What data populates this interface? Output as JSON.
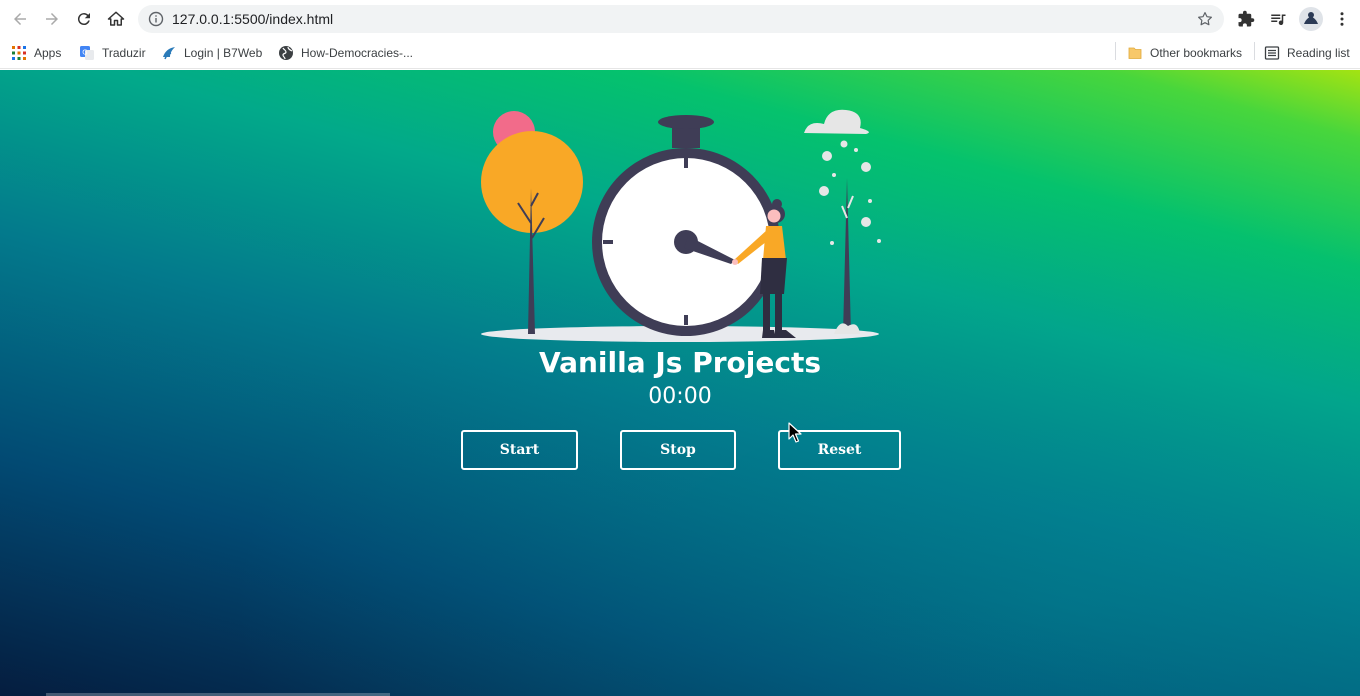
{
  "browser": {
    "url": "127.0.0.1:5500/index.html",
    "icons": [
      "back-arrow-icon",
      "forward-arrow-icon",
      "reload-icon",
      "home-icon",
      "info-icon",
      "star-icon",
      "extensions-icon",
      "reading-list-icon",
      "profile-avatar",
      "more-menu-icon"
    ]
  },
  "bookmarks": {
    "apps": "Apps",
    "items": [
      {
        "label": "Traduzir",
        "icon": "translate-icon"
      },
      {
        "label": "Login | B7Web",
        "icon": "b7web-icon"
      },
      {
        "label": "How-Democracies-...",
        "icon": "globe-icon"
      }
    ],
    "other": "Other bookmarks",
    "reading_list": "Reading list"
  },
  "page": {
    "title": "Vanilla Js Projects",
    "timer": "00:00",
    "buttons": {
      "start": "Start",
      "stop": "Stop",
      "reset": "Reset"
    },
    "colors": {
      "gradient_dark": "#051d3f",
      "gradient_mid": "#037a8c",
      "gradient_green": "#05c26d",
      "gradient_lime": "#a4e312",
      "accent_orange": "#f9a826",
      "accent_pink": "#f26b8a",
      "clock_dark": "#3f3d56"
    }
  }
}
